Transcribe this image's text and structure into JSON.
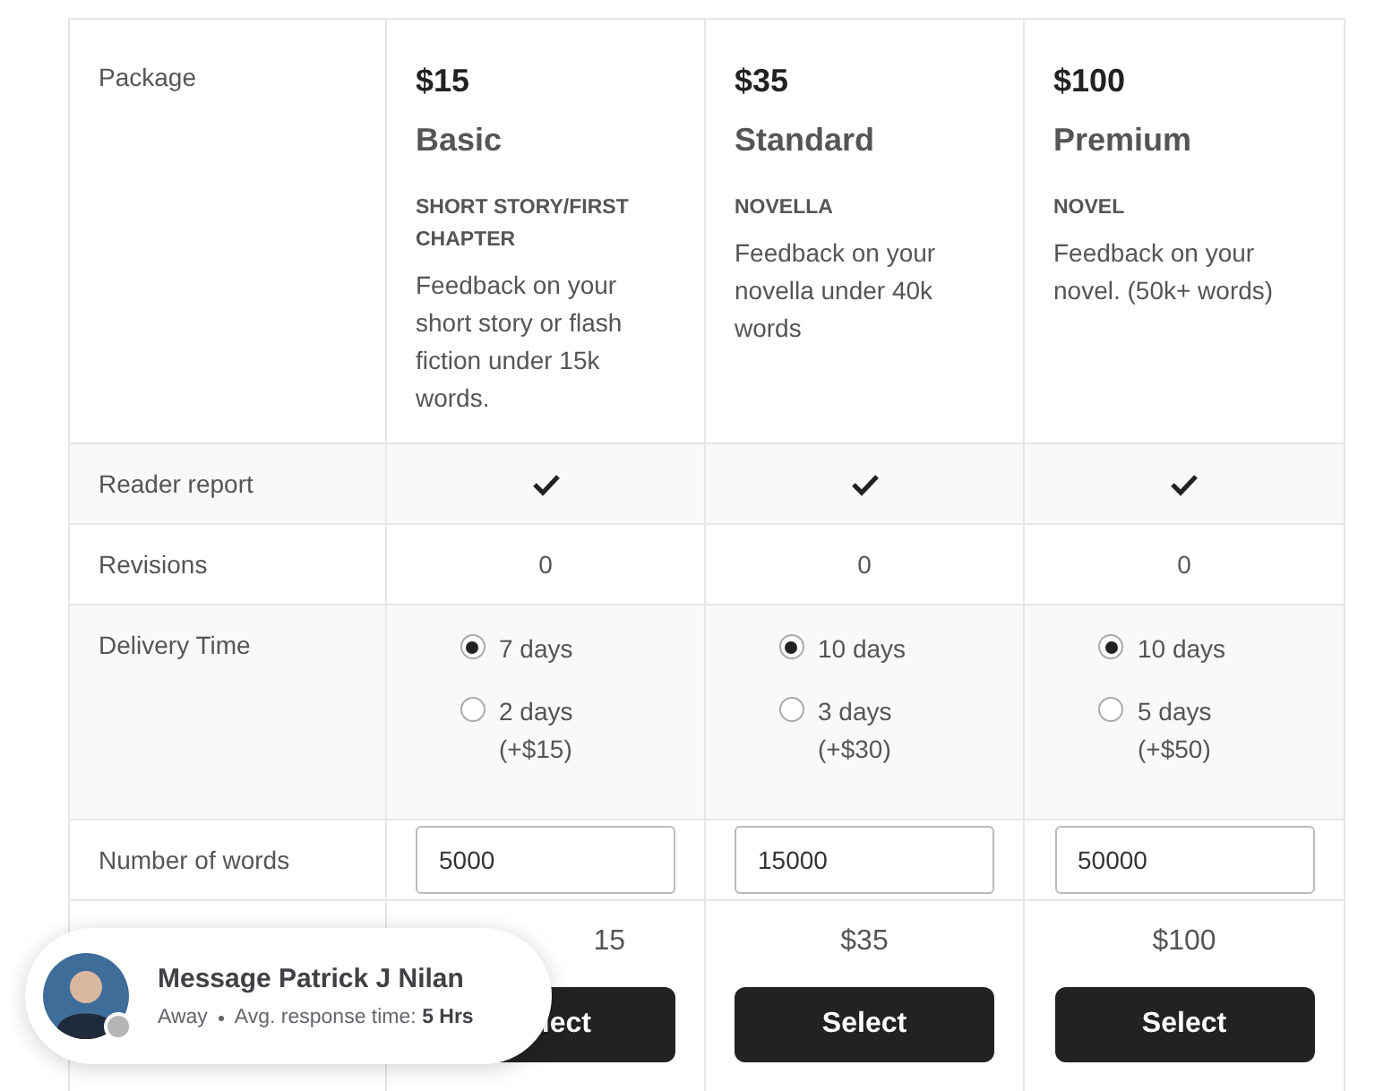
{
  "package_label": "Package",
  "packages": [
    {
      "price": "$15",
      "name": "Basic",
      "category": "SHORT STORY/FIRST CHAPTER",
      "description": "Feedback on your short story or flash fiction under 15k words."
    },
    {
      "price": "$35",
      "name": "Standard",
      "category": "NOVELLA",
      "description": "Feedback on your novella under 40k words"
    },
    {
      "price": "$100",
      "name": "Premium",
      "category": "NOVEL",
      "description": "Feedback on your novel. (50k+ words)"
    }
  ],
  "features": [
    {
      "label": "Reader report",
      "kind": "check",
      "values": [
        true,
        true,
        true
      ]
    },
    {
      "label": "Revisions",
      "kind": "text",
      "values": [
        "0",
        "0",
        "0"
      ]
    },
    {
      "label": "Delivery Time",
      "kind": "radio",
      "values": [
        [
          {
            "label": "7 days",
            "selected": true
          },
          {
            "label": "2 days (+$15)",
            "selected": false
          }
        ],
        [
          {
            "label": "10 days",
            "selected": true
          },
          {
            "label": "3 days (+$30)",
            "selected": false
          }
        ],
        [
          {
            "label": "10 days",
            "selected": true
          },
          {
            "label": "5 days (+$50)",
            "selected": false
          }
        ]
      ]
    },
    {
      "label": "Number of words",
      "kind": "input",
      "values": [
        "5000",
        "15000",
        "50000"
      ]
    }
  ],
  "totals": [
    "15",
    "$35",
    "$100"
  ],
  "select_buttons": [
    "lect",
    "Select",
    "Select"
  ],
  "chat": {
    "title": "Message Patrick J Nilan",
    "status": "Away",
    "response_label": "Avg. response time:",
    "response_value": "5 Hrs",
    "online": false
  }
}
